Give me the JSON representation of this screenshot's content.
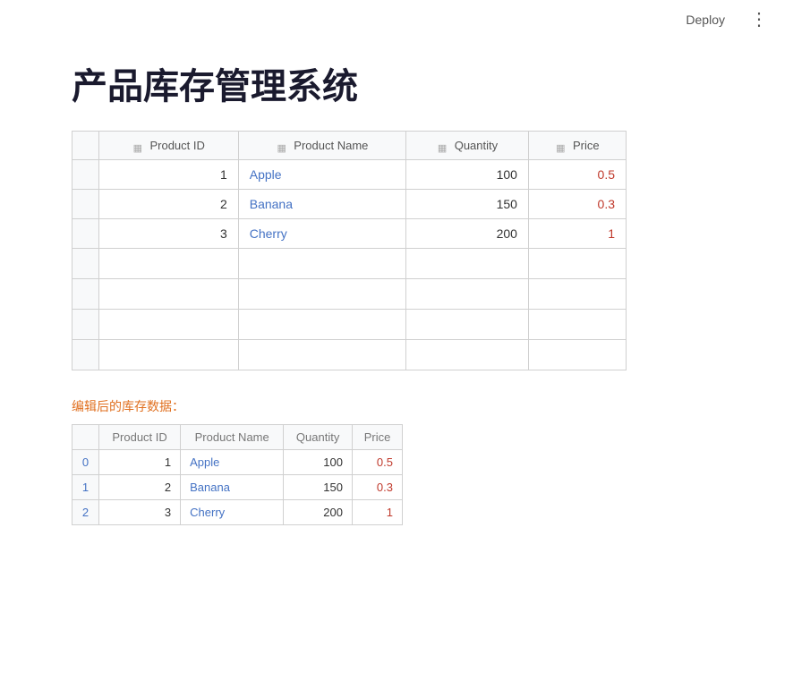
{
  "topbar": {
    "deploy_label": "Deploy",
    "more_icon": "⋮"
  },
  "page": {
    "title": "产品库存管理系统"
  },
  "main_table": {
    "columns": [
      {
        "label": "Product ID",
        "filter": true
      },
      {
        "label": "Product Name",
        "filter": true
      },
      {
        "label": "Quantity",
        "filter": true
      },
      {
        "label": "Price",
        "filter": true
      }
    ],
    "rows": [
      {
        "id": 1,
        "name": "Apple",
        "quantity": 100,
        "price": "0.5"
      },
      {
        "id": 2,
        "name": "Banana",
        "quantity": 150,
        "price": "0.3"
      },
      {
        "id": 3,
        "name": "Cherry",
        "quantity": 200,
        "price": "1"
      }
    ],
    "empty_rows": 4
  },
  "section_label": "编辑后的库存数据：",
  "secondary_table": {
    "columns": [
      "Product ID",
      "Product Name",
      "Quantity",
      "Price"
    ],
    "rows": [
      {
        "idx": 0,
        "id": 1,
        "name": "Apple",
        "quantity": 100,
        "price": "0.5"
      },
      {
        "idx": 1,
        "id": 2,
        "name": "Banana",
        "quantity": 150,
        "price": "0.3"
      },
      {
        "idx": 2,
        "id": 3,
        "name": "Cherry",
        "quantity": 200,
        "price": "1"
      }
    ]
  }
}
